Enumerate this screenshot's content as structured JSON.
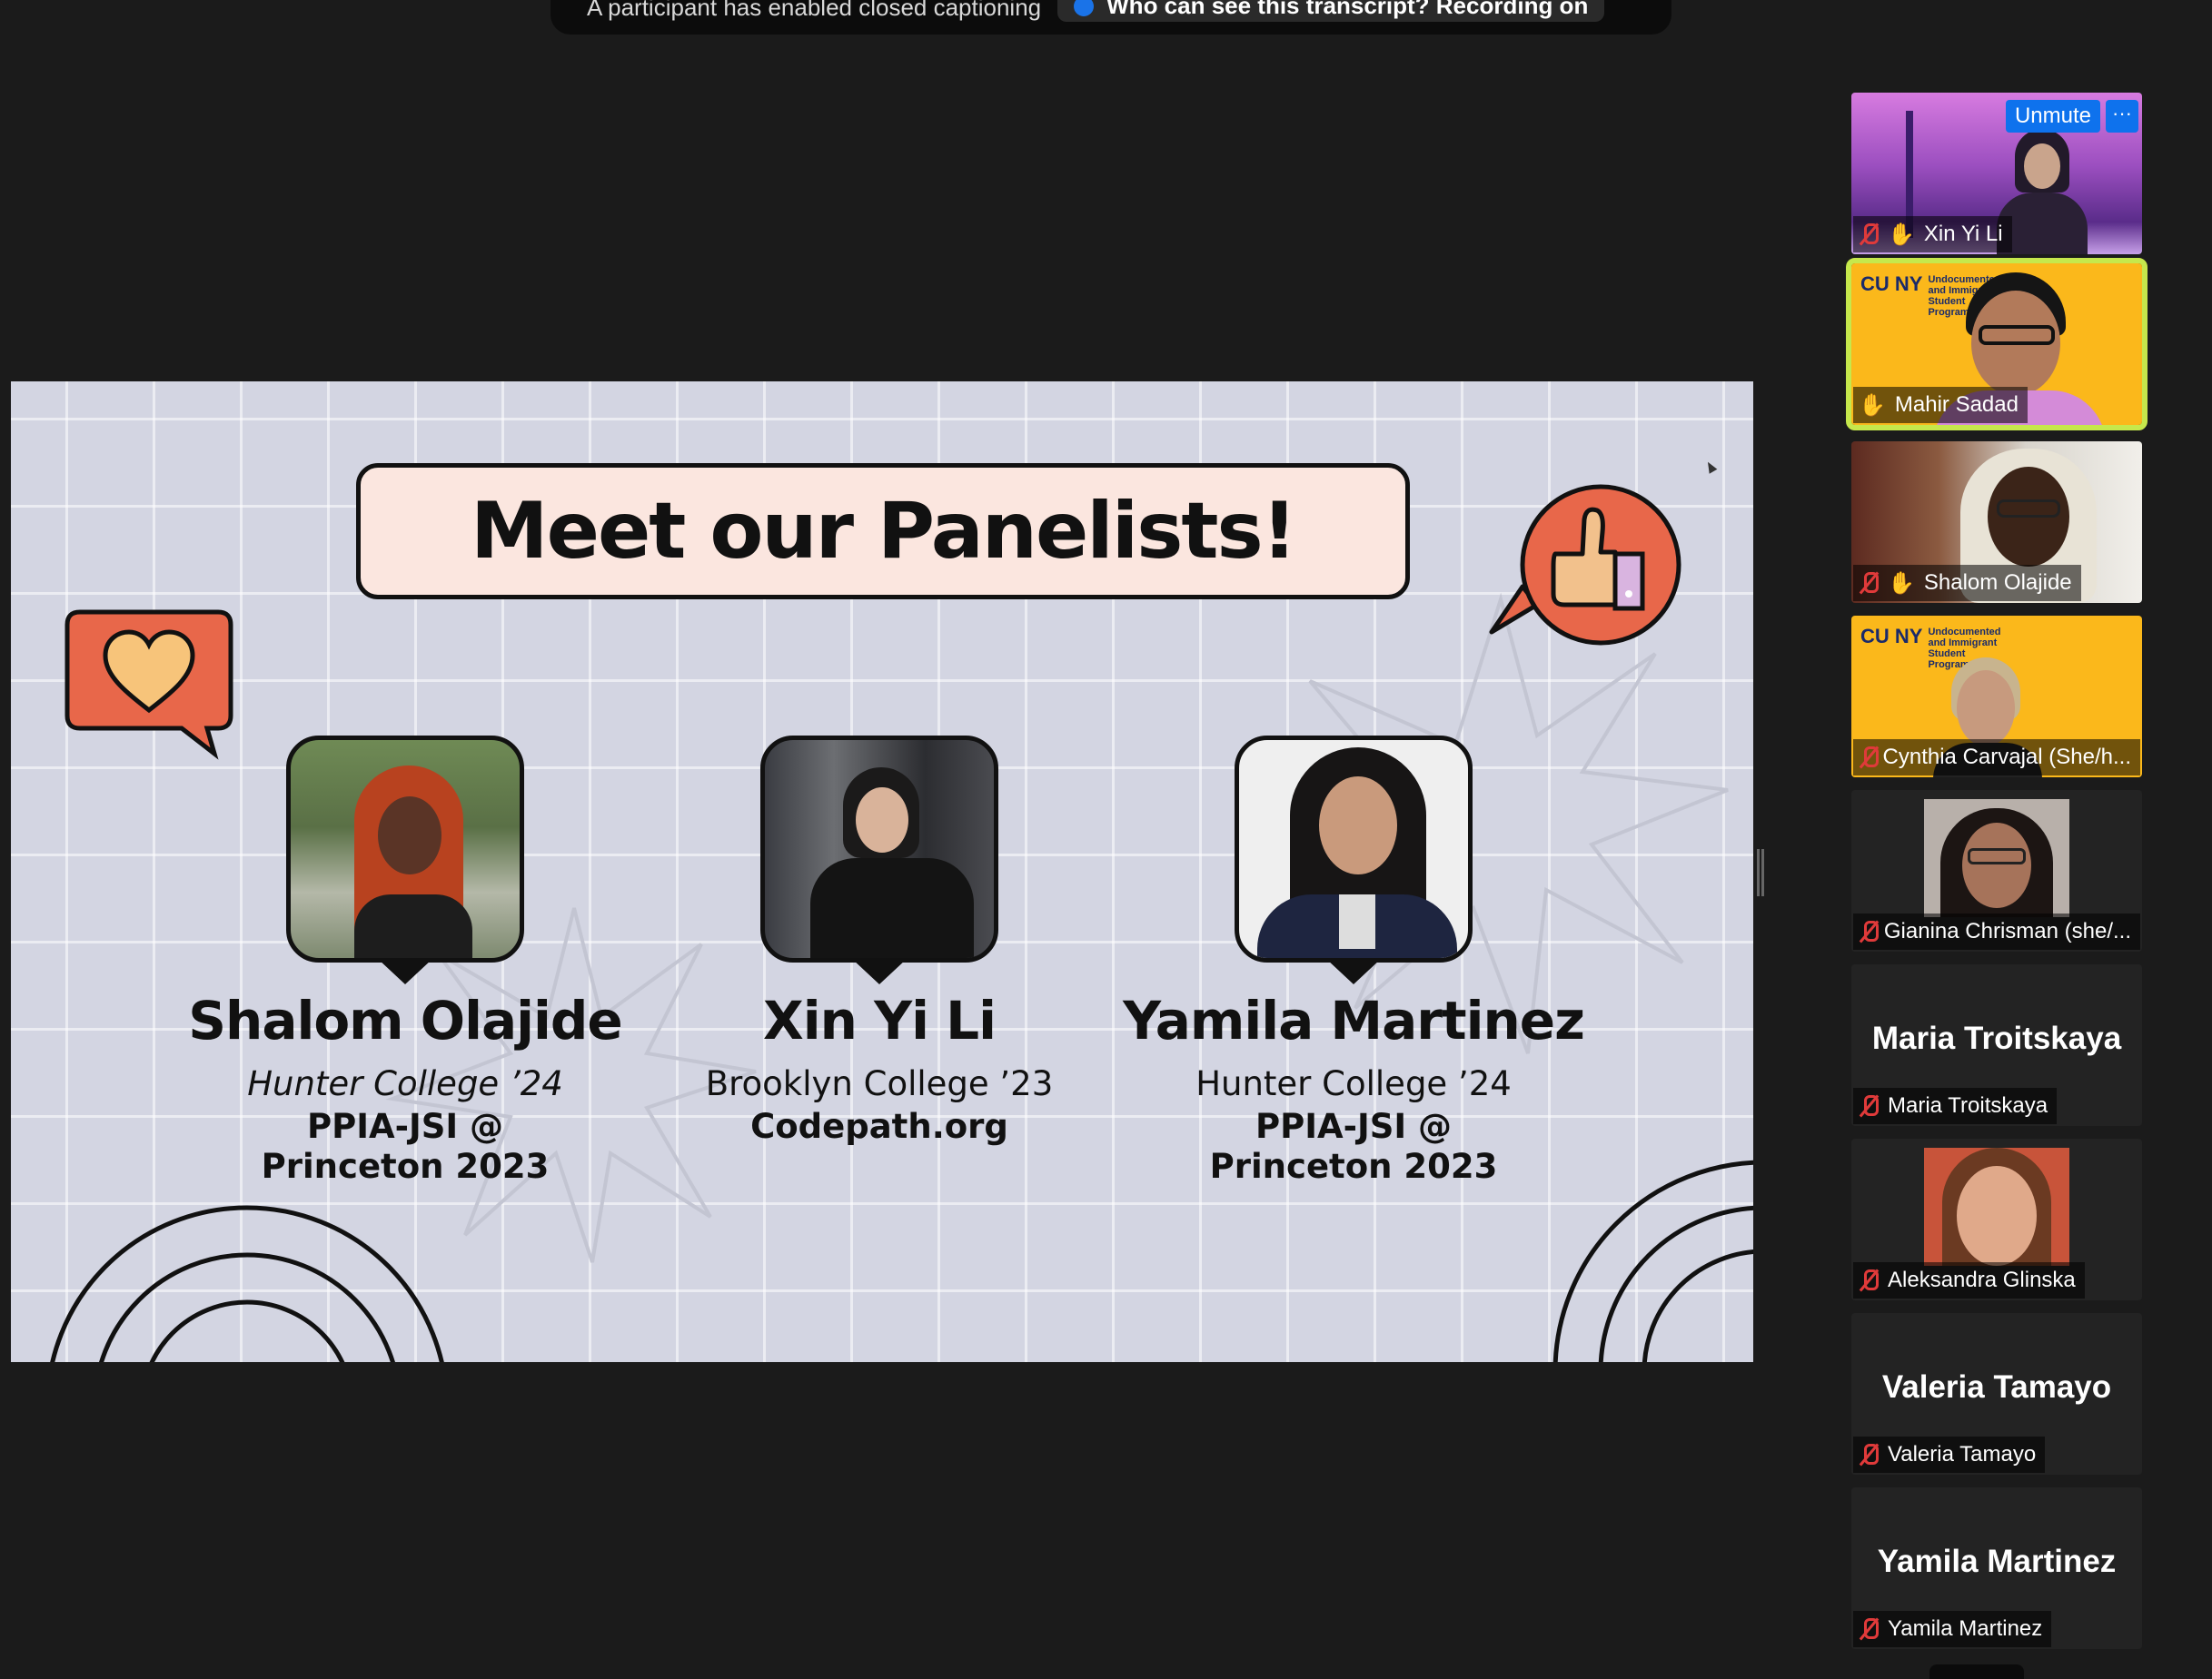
{
  "banner": {
    "notice": "A participant has enabled closed captioning",
    "pill_text": "Who can see this transcript? Recording on"
  },
  "slide": {
    "title": "Meet our Panelists!",
    "panelists": [
      {
        "name": "Shalom Olajide",
        "line1": "Hunter College ’24",
        "line2": "PPIA-JSI @ Princeton 2023"
      },
      {
        "name": "Xin Yi Li",
        "line1": "Brooklyn College ’23",
        "line2": "Codepath.org"
      },
      {
        "name": "Yamila Martinez",
        "line1": "Hunter College ’24",
        "line2": "PPIA-JSI @ Princeton 2023"
      }
    ]
  },
  "participants": [
    {
      "name": "Xin Yi Li",
      "muted": true,
      "hand_raised": true,
      "unmute_label": "Unmute",
      "more_label": "···"
    },
    {
      "name": "Mahir Sadad",
      "muted": false,
      "hand_raised": true,
      "active_speaker": true,
      "bg_text": "Undocumented and Immigrant Student Programs"
    },
    {
      "name": "Shalom Olajide",
      "muted": true,
      "hand_raised": true
    },
    {
      "name": "Cynthia Carvajal (She/h...",
      "muted": true,
      "bg_text": "Undocumented and Immigrant Student Programs"
    },
    {
      "name": "Gianina Chrisman (she/...",
      "muted": true
    },
    {
      "name": "Maria Troitskaya",
      "muted": true,
      "display_big": "Maria Troitskaya"
    },
    {
      "name": "Aleksandra Glinska",
      "muted": true
    },
    {
      "name": "Valeria Tamayo",
      "muted": true,
      "display_big": "Valeria Tamayo"
    },
    {
      "name": "Yamila Martinez",
      "muted": true,
      "display_big": "Yamila Martinez"
    }
  ],
  "cuny_logo": "CU NY",
  "colors": {
    "background": "#1b1b1b",
    "slide_bg": "#d3d5e2",
    "accent_orange": "#e8674a",
    "active_speaker": "#c6e84c",
    "zoom_blue": "#0e72ed",
    "mic_off_red": "#e03a3a",
    "cuny_yellow": "#fbb81b"
  }
}
